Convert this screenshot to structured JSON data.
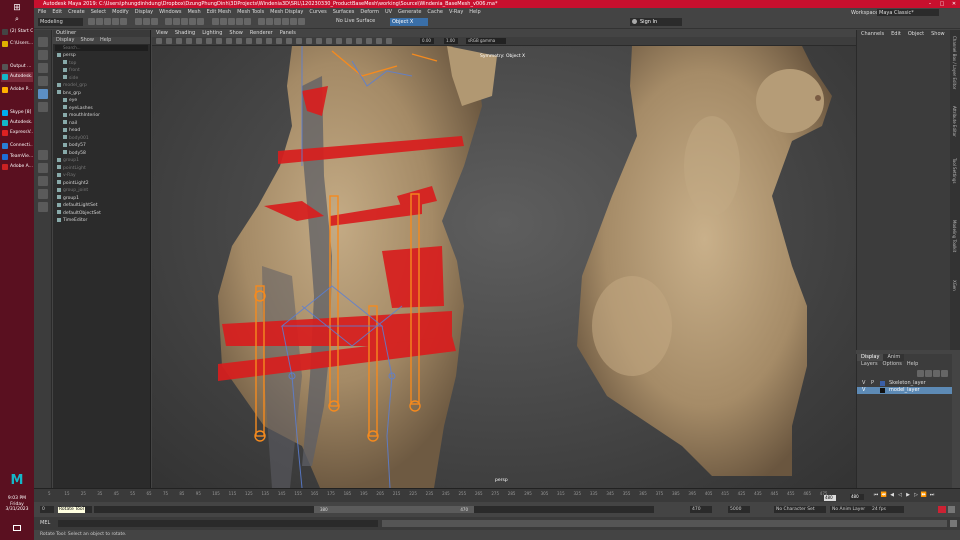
{
  "taskbar": {
    "items": [
      {
        "label": "(2) Start C..."
      },
      {
        "label": "C:\\Users..."
      },
      {
        "label": "Output ..."
      },
      {
        "label": "Autodesk..."
      },
      {
        "label": "Adobe P..."
      },
      {
        "label": "Skype [8]"
      },
      {
        "label": "Autodesk..."
      },
      {
        "label": "ExpressV..."
      },
      {
        "label": "Connecti..."
      },
      {
        "label": "TeamVie..."
      },
      {
        "label": "Adobe A..."
      }
    ],
    "clock_time": "9:03 PM",
    "clock_day": "Friday",
    "clock_date": "3/31/2023"
  },
  "titlebar": {
    "title": "Autodesk Maya 2019: C:\\Users\\phungdinhdung\\Dropbox\\DzungPhungDinh\\3DProjects\\Windenia3D\\SRL\\120230330_ProductBaseMesh\\working\\Source\\Windenia_BaseMesh_v006.ma*"
  },
  "menubar": {
    "items": [
      "File",
      "Edit",
      "Create",
      "Select",
      "Modify",
      "Display",
      "Windows",
      "Mesh",
      "Edit Mesh",
      "Mesh Tools",
      "Mesh Display",
      "Curves",
      "Surfaces",
      "Deform",
      "UV",
      "Generate",
      "Cache",
      "V-Ray",
      "Help"
    ],
    "workspace_label": "Workspace :",
    "workspace_value": "Maya Classic*"
  },
  "statusline": {
    "mode": "Modeling",
    "live_surface": "No Live Surface",
    "symmetry": "Object X",
    "sign_in": "Sign In"
  },
  "outliner": {
    "title": "Outliner",
    "menus": [
      "Display",
      "Show",
      "Help"
    ],
    "search_placeholder": "Search...",
    "rows": [
      {
        "label": "persp",
        "dim": false,
        "indent": 0
      },
      {
        "label": "top",
        "dim": true,
        "indent": 1
      },
      {
        "label": "front",
        "dim": true,
        "indent": 1
      },
      {
        "label": "side",
        "dim": true,
        "indent": 1
      },
      {
        "label": "model_grp",
        "dim": true,
        "indent": 0
      },
      {
        "label": "bns_grp",
        "dim": false,
        "indent": 0
      },
      {
        "label": "eye",
        "dim": false,
        "indent": 1
      },
      {
        "label": "eyeLashes",
        "dim": false,
        "indent": 1
      },
      {
        "label": "mouthInterior",
        "dim": false,
        "indent": 1
      },
      {
        "label": "nail",
        "dim": false,
        "indent": 1
      },
      {
        "label": "head",
        "dim": false,
        "indent": 1
      },
      {
        "label": "body001",
        "dim": true,
        "indent": 1
      },
      {
        "label": "body57",
        "dim": false,
        "indent": 1
      },
      {
        "label": "body58",
        "dim": false,
        "indent": 1
      },
      {
        "label": "group1",
        "dim": true,
        "indent": 0
      },
      {
        "label": "pointLight",
        "dim": true,
        "indent": 0
      },
      {
        "label": "v-Ray",
        "dim": true,
        "indent": 0
      },
      {
        "label": "pointLight2",
        "dim": false,
        "indent": 0
      },
      {
        "label": "group_joint",
        "dim": true,
        "indent": 0
      },
      {
        "label": "group1",
        "dim": false,
        "indent": 0
      },
      {
        "label": "defaultLightSet",
        "dim": false,
        "indent": 0
      },
      {
        "label": "defaultObjectSet",
        "dim": false,
        "indent": 0
      },
      {
        "label": "TimeEditor",
        "dim": false,
        "indent": 0
      }
    ]
  },
  "viewport": {
    "menus": [
      "View",
      "Shading",
      "Lighting",
      "Show",
      "Renderer",
      "Panels"
    ],
    "field_a": "0.00",
    "field_b": "1.00",
    "color_space": "sRGB gamma",
    "symmetry_label": "Symmetry: Object X",
    "camera_label": "persp"
  },
  "channelbox": {
    "menus": [
      "Channels",
      "Edit",
      "Object",
      "Show"
    ],
    "vtabs": [
      "Channel Box / Layer Editor",
      "Attribute Editor",
      "Tool Settings",
      "Modeling Toolkit",
      "XGen"
    ]
  },
  "layers": {
    "tabs": [
      "Display",
      "Anim"
    ],
    "menus": [
      "Layers",
      "Options",
      "Help"
    ],
    "rows": [
      {
        "v": "V",
        "p": "P",
        "name": "Skeleton_layer",
        "color": "#3a5fa8",
        "selected": false
      },
      {
        "v": "V",
        "p": "",
        "name": "model_layer",
        "color": "#111111",
        "selected": true
      }
    ]
  },
  "timeline": {
    "ticks": [
      "5",
      "10",
      "15",
      "20",
      "25",
      "30",
      "35",
      "40",
      "45",
      "50",
      "55",
      "60",
      "65",
      "70",
      "75",
      "80",
      "85",
      "90",
      "95",
      "100",
      "105",
      "110",
      "115",
      "120",
      "125",
      "130",
      "135",
      "140",
      "145",
      "150",
      "155",
      "160",
      "165",
      "170",
      "175",
      "180",
      "185",
      "190",
      "195",
      "200",
      "205",
      "210",
      "215",
      "220",
      "225",
      "230",
      "235",
      "240",
      "245",
      "250",
      "255",
      "260",
      "265",
      "270",
      "275",
      "280",
      "285",
      "290",
      "295",
      "300",
      "305",
      "310",
      "315",
      "320",
      "325",
      "330",
      "335",
      "340",
      "345",
      "350",
      "355",
      "360",
      "365",
      "370",
      "375",
      "380",
      "385",
      "390",
      "395",
      "400",
      "405",
      "410",
      "415",
      "420",
      "425",
      "430",
      "435",
      "440",
      "445",
      "450",
      "455",
      "460",
      "465",
      "470",
      "475"
    ],
    "current_frame": "480",
    "end_marker": "480"
  },
  "range": {
    "start": "0",
    "tooltip": "Rotate Tool",
    "start2": "0",
    "range_start": "380",
    "range_end": "470",
    "anim_end": "470",
    "anim_end2": "5000",
    "character_set": "No Character Set",
    "anim_layer": "No Anim Layer",
    "fps": "24 fps"
  },
  "mel": {
    "label": "MEL"
  },
  "help_line": "Rotate Tool: Select an object to rotate."
}
